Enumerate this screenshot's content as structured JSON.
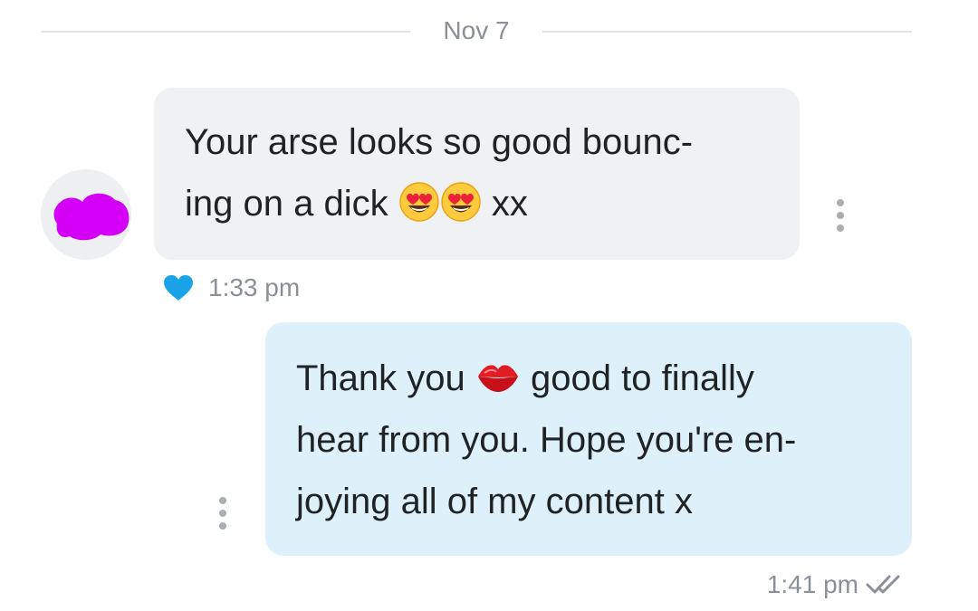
{
  "date_divider": {
    "label": "Nov 7"
  },
  "incoming_message": {
    "lines": [
      "Your arse looks so good bounc-",
      "ing on a dick"
    ],
    "suffix": "xx",
    "emojis": [
      "heart-eyes-emoji",
      "heart-eyes-emoji"
    ],
    "time": "1:33 pm",
    "reaction_icon": "heart-icon",
    "reaction_color": "#1aa3e8"
  },
  "outgoing_message": {
    "line1_before": "Thank you",
    "line1_after": "good to finally",
    "line2": "hear from you. Hope you're en-",
    "line3": "joying all of my content x",
    "emoji": "kiss-mark-emoji",
    "time": "1:41 pm",
    "status_icon": "double-check-icon"
  },
  "colors": {
    "incoming_bubble": "#f0f1f3",
    "outgoing_bubble": "#def1fb",
    "avatar_censor": "#d400f5"
  }
}
